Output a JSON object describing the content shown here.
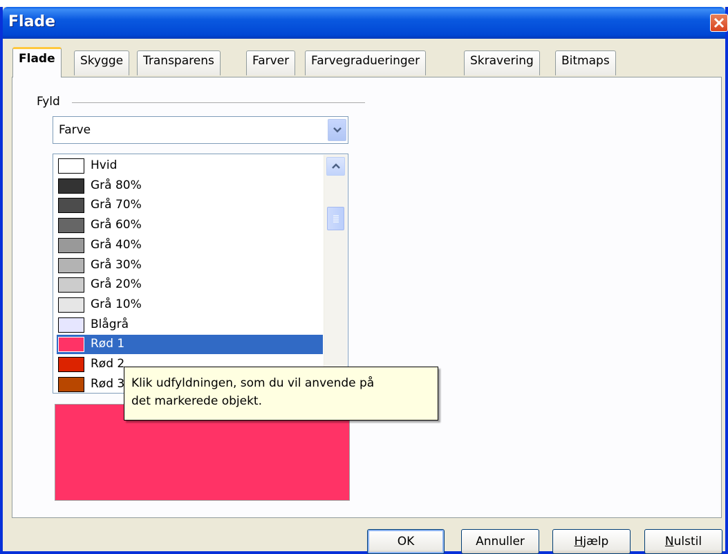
{
  "window": {
    "title": "Flade"
  },
  "tabs": [
    {
      "label": "Flade",
      "active": true
    },
    {
      "label": "Skygge"
    },
    {
      "label": "Transparens"
    },
    {
      "label": "Farver"
    },
    {
      "label": "Farvegradueringer"
    },
    {
      "label": "Skravering"
    },
    {
      "label": "Bitmaps"
    }
  ],
  "fill": {
    "group_label": "Fyld",
    "type_value": "Farve",
    "colors": [
      {
        "label": "Hvid",
        "color": "#FFFFFF"
      },
      {
        "label": "Grå 80%",
        "color": "#333333"
      },
      {
        "label": "Grå 70%",
        "color": "#4C4C4C"
      },
      {
        "label": "Grå 60%",
        "color": "#666666"
      },
      {
        "label": "Grå 40%",
        "color": "#999999"
      },
      {
        "label": "Grå 30%",
        "color": "#B3B3B3"
      },
      {
        "label": "Grå 20%",
        "color": "#CCCCCC"
      },
      {
        "label": "Grå 10%",
        "color": "#E6E6E6"
      },
      {
        "label": "Blågrå",
        "color": "#E6E6FF"
      },
      {
        "label": "Rød 1",
        "color": "#FF3366",
        "selected": true
      },
      {
        "label": "Rød 2",
        "color": "#DC2300"
      },
      {
        "label": "Rød 3",
        "color": "#B84700"
      }
    ],
    "preview_color": "#FF3366"
  },
  "tooltip": {
    "text": "Klik udfyldningen, som du vil anvende på\ndet markerede objekt."
  },
  "buttons": {
    "ok": "OK",
    "cancel": "Annuller",
    "help_mnemonic": "H",
    "help_rest": "jælp",
    "reset_mnemonic": "N",
    "reset_rest": "ulstil"
  },
  "icons": {
    "close": "close-icon",
    "combo": "chevron-down-icon",
    "scroll_up": "chevron-up-icon",
    "scroll_grip": "grip-icon"
  },
  "colors": {
    "titlebar": "#0A59E0",
    "selection": "#316AC5",
    "tooltip_bg": "#FFFFE1",
    "dialog_bg": "#ECE9D8"
  }
}
